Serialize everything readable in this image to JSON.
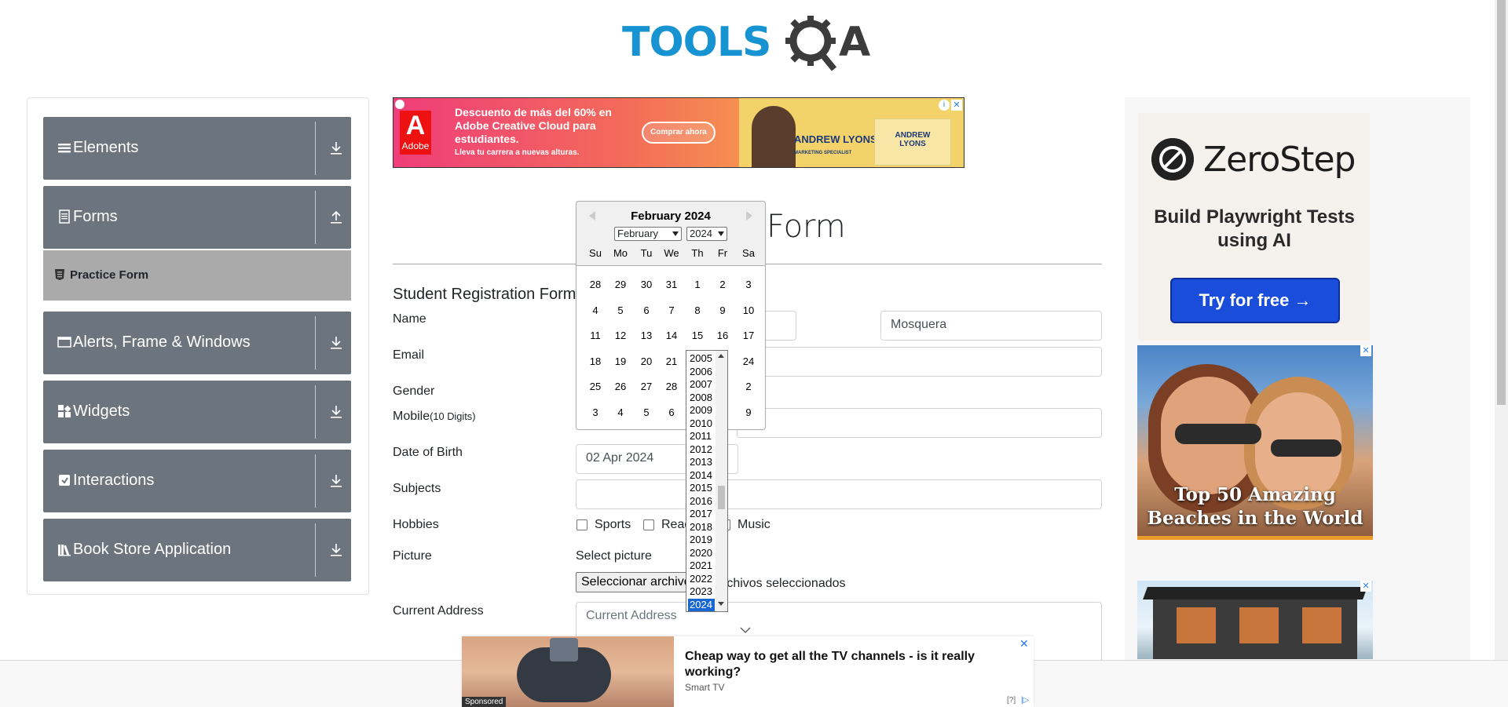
{
  "header": {
    "logo_text": "TOOLS",
    "logo_text_end": "A"
  },
  "sidebar": {
    "groups": [
      {
        "label": "Elements"
      },
      {
        "label": "Forms"
      },
      {
        "label": "Alerts, Frame & Windows"
      },
      {
        "label": "Widgets"
      },
      {
        "label": "Interactions"
      },
      {
        "label": "Book Store Application"
      }
    ],
    "active_item": "Practice Form"
  },
  "top_ad": {
    "logo_letter": "A",
    "logo_brand": "Adobe",
    "headline": "Descuento de más del 60% en Adobe Creative Cloud para estudiantes.",
    "subline": "Lleva tu carrera a nuevas alturas.",
    "cta": "Comprar ahora",
    "person_name": "ANDREW LYONS",
    "person_role": "MARKETING SPECIALIST",
    "card_name": "ANDREW LYONS",
    "info_glyph": "i",
    "close_glyph": "✕"
  },
  "page": {
    "title_visible": "Form",
    "form_heading": "Student Registration Form"
  },
  "form": {
    "name_label": "Name",
    "last_name_value": "Mosquera",
    "email_label": "Email",
    "gender_label": "Gender",
    "mobile_label": "Mobile",
    "mobile_hint": "(10 Digits)",
    "dob_label": "Date of Birth",
    "dob_value": "02 Apr 2024",
    "subjects_label": "Subjects",
    "hobbies_label": "Hobbies",
    "hobbies": [
      "Sports",
      "Read",
      "Music"
    ],
    "picture_label": "Picture",
    "select_picture": "Select picture",
    "file_button": "Seleccionar archivo",
    "file_status": "rchivos seleccionados",
    "address_label": "Current Address",
    "address_placeholder": "Current Address"
  },
  "datepicker": {
    "title": "February 2024",
    "month_select": "February",
    "year_select": "2024",
    "weekdays": [
      "Su",
      "Mo",
      "Tu",
      "We",
      "Th",
      "Fr",
      "Sa"
    ],
    "weeks": [
      [
        "28",
        "29",
        "30",
        "31",
        "1",
        "2",
        "3"
      ],
      [
        "4",
        "5",
        "6",
        "7",
        "8",
        "9",
        "10"
      ],
      [
        "11",
        "12",
        "13",
        "14",
        "15",
        "16",
        "17"
      ],
      [
        "18",
        "19",
        "20",
        "21",
        "",
        "",
        "24"
      ],
      [
        "25",
        "26",
        "27",
        "28",
        "",
        "",
        "2"
      ],
      [
        "3",
        "4",
        "5",
        "6",
        "",
        "",
        "9"
      ]
    ]
  },
  "year_list": {
    "years": [
      "2005",
      "2006",
      "2007",
      "2008",
      "2009",
      "2010",
      "2011",
      "2012",
      "2013",
      "2014",
      "2015",
      "2016",
      "2017",
      "2018",
      "2019",
      "2020",
      "2021",
      "2022",
      "2023",
      "2024"
    ],
    "selected": "2024"
  },
  "right_ads": {
    "zerostep_name": "ZeroStep",
    "zerostep_tagline": "Build Playwright Tests using AI",
    "zerostep_cta": "Try for free →",
    "beach_caption": "Top 50 Amazing Beaches in the World",
    "close_glyph": "✕"
  },
  "bottom_ad": {
    "title": "Cheap way to get all the TV channels - is it really working?",
    "source": "Smart TV",
    "sponsored": "Sponsored",
    "close_glyph": "✕",
    "help": "[?]",
    "choices_glyph": "|▷"
  },
  "colors": {
    "sidebar_header": "#6c757d",
    "active_item": "#aaaaaa",
    "logo_blue": "#1793d1",
    "cta_blue": "#1b4ddb",
    "year_selected": "#1967d2"
  },
  "icons": [
    "hamburger-icon",
    "document-icon",
    "window-icon",
    "widget-grid-icon",
    "interaction-icon",
    "book-icon",
    "download-arrow-icon",
    "upload-arrow-icon"
  ]
}
